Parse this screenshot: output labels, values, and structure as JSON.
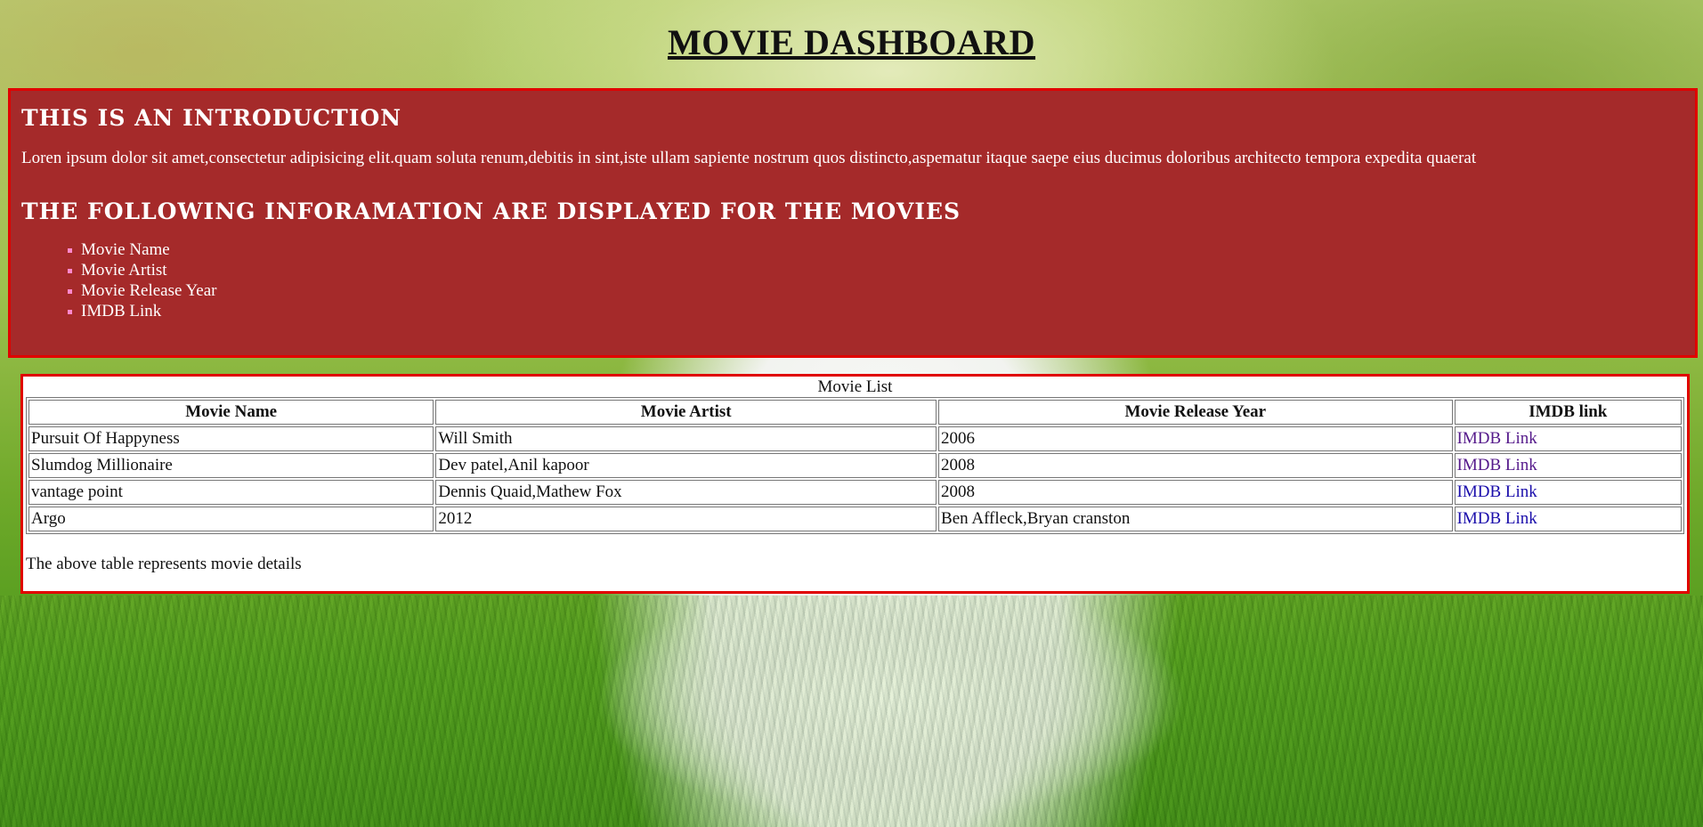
{
  "page": {
    "title": "MOVIE DASHBOARD"
  },
  "intro": {
    "heading": "THIS IS AN INTRODUCTION",
    "paragraph": "Loren ipsum dolor sit amet,consectetur adipisicing elit.quam soluta renum,debitis in sint,iste ullam sapiente nostrum quos distincto,aspematur itaque saepe eius ducimus doloribus architecto tempora expedita quaerat",
    "subheading": "THE FOLLOWING INFORAMATION ARE DISPLAYED FOR THE MOVIES",
    "items": [
      "Movie Name",
      "Movie Artist",
      "Movie Release Year",
      "IMDB Link"
    ]
  },
  "table": {
    "caption": "Movie List",
    "headers": [
      "Movie Name",
      "Movie Artist",
      "Movie Release Year",
      "IMDB link"
    ],
    "rows": [
      [
        "Pursuit Of Happyness",
        "Will Smith",
        "2006",
        "IMDB Link"
      ],
      [
        "Slumdog Millionaire",
        "Dev patel,Anil kapoor",
        "2008",
        "IMDB Link"
      ],
      [
        "vantage point",
        "Dennis Quaid,Mathew Fox",
        "2008",
        "IMDB Link"
      ],
      [
        "Argo",
        "2012",
        "Ben Affleck,Bryan cranston",
        "IMDB Link"
      ]
    ],
    "footer_text": "The above table represents movie details"
  },
  "colors": {
    "intro_background": "#a52a2a",
    "border_accent": "#e00000",
    "visited_link": "#551a8b",
    "unvisited_link": "#1a0dab"
  }
}
